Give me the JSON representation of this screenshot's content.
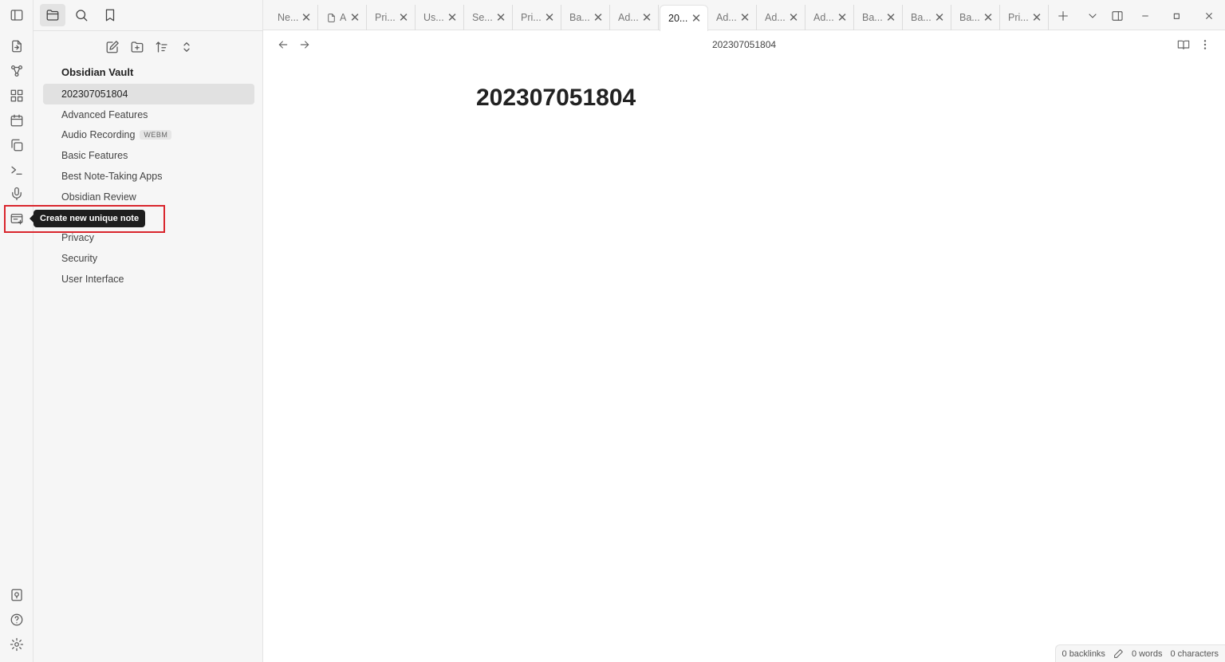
{
  "sidebar": {
    "vault_name": "Obsidian Vault",
    "files": [
      {
        "name": "202307051804",
        "active": true
      },
      {
        "name": "Advanced Features"
      },
      {
        "name": "Audio Recording",
        "badge": "WEBM"
      },
      {
        "name": "Basic Features"
      },
      {
        "name": "Best Note-Taking Apps"
      },
      {
        "name": "Obsidian Review"
      },
      {
        "name": ""
      },
      {
        "name": "Privacy"
      },
      {
        "name": "Security"
      },
      {
        "name": "User Interface"
      }
    ]
  },
  "tabs": [
    {
      "label": "Ne..."
    },
    {
      "label": "A",
      "has_file_icon": true
    },
    {
      "label": "Pri..."
    },
    {
      "label": "Us..."
    },
    {
      "label": "Se..."
    },
    {
      "label": "Pri..."
    },
    {
      "label": "Ba..."
    },
    {
      "label": "Ad..."
    },
    {
      "label": "20...",
      "active": true
    },
    {
      "label": "Ad..."
    },
    {
      "label": "Ad..."
    },
    {
      "label": "Ad..."
    },
    {
      "label": "Ba..."
    },
    {
      "label": "Ba..."
    },
    {
      "label": "Ba..."
    },
    {
      "label": "Pri..."
    }
  ],
  "editor": {
    "header_title": "202307051804",
    "note_title": "202307051804"
  },
  "tooltip": {
    "text": "Create new unique note"
  },
  "statusbar": {
    "backlinks": "0 backlinks",
    "words": "0 words",
    "characters": "0 characters"
  },
  "colors": {
    "highlight": "#d9262d"
  }
}
